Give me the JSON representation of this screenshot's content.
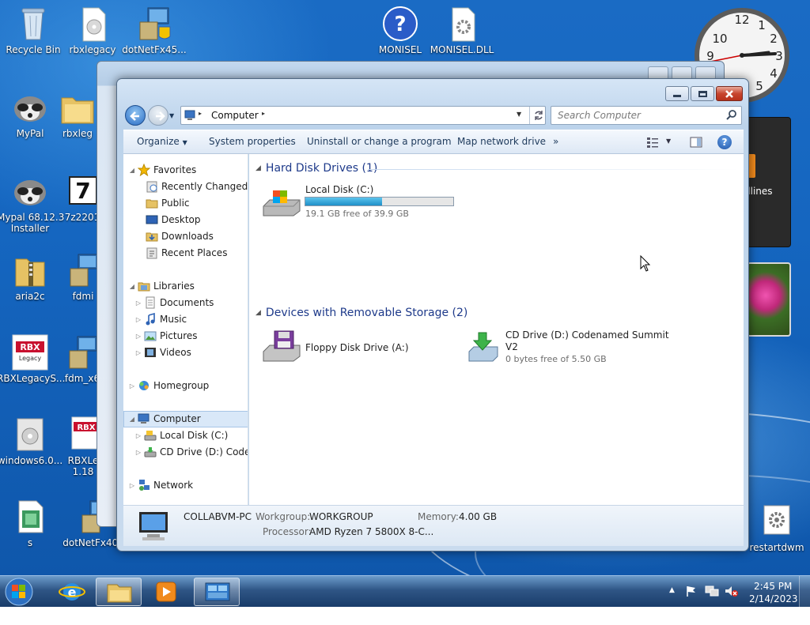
{
  "desktop": {
    "icons": [
      {
        "label": "Recycle Bin",
        "icon": "recycle-bin-icon"
      },
      {
        "label": "rbxlegacy",
        "icon": "disc-file-icon"
      },
      {
        "label": "dotNetFx45...",
        "icon": "installer-icon"
      },
      {
        "label": "MONISEL",
        "icon": "help-icon"
      },
      {
        "label": "MONISEL.DLL",
        "icon": "dll-file-icon"
      },
      {
        "label": "MyPal",
        "icon": "raccoon-icon"
      },
      {
        "label": "rbxleg",
        "icon": "folder-icon"
      },
      {
        "label": "Mypal 68.12.3",
        "label2": "Installer",
        "icon": "raccoon-icon"
      },
      {
        "label": "7z2201",
        "icon": "7zip-icon"
      },
      {
        "label": "aria2c",
        "icon": "zip-folder-icon"
      },
      {
        "label": "fdmi",
        "icon": "installer-icon"
      },
      {
        "label": "RBXLegacyS...",
        "icon": "rbx-legacy-icon"
      },
      {
        "label": "fdm_x6",
        "icon": "installer-icon"
      },
      {
        "label": "windows6.0...",
        "icon": "update-package-icon"
      },
      {
        "label": "RBXLe",
        "label2": "1.18",
        "icon": "rbx-legacy-icon"
      },
      {
        "label": "s",
        "icon": "script-icon"
      },
      {
        "label": "dotNetFx40...",
        "icon": "installer-icon"
      },
      {
        "label": "restartdwm",
        "icon": "settings-file-icon"
      }
    ],
    "gadget_headlines_text": "dlines"
  },
  "window": {
    "address": {
      "path_icon": "computer-icon",
      "segment": "Computer",
      "sep": "▸"
    },
    "search_placeholder": "Search Computer",
    "toolbar": {
      "organize": "Organize",
      "system_properties": "System properties",
      "uninstall": "Uninstall or change a program",
      "map_network": "Map network drive",
      "more": "»"
    },
    "nav": {
      "favorites": "Favorites",
      "recently_changed": "Recently Changed",
      "public": "Public",
      "desktop": "Desktop",
      "downloads": "Downloads",
      "recent_places": "Recent Places",
      "libraries": "Libraries",
      "documents": "Documents",
      "music": "Music",
      "pictures": "Pictures",
      "videos": "Videos",
      "homegroup": "Homegroup",
      "computer": "Computer",
      "local_disk": "Local Disk (C:)",
      "cd_drive": "CD Drive (D:) Coden",
      "network": "Network"
    },
    "content": {
      "hdd_header": "Hard Disk Drives (1)",
      "local_disk": {
        "name": "Local Disk (C:)",
        "free": "19.1 GB free of 39.9 GB",
        "used_fraction": 0.52
      },
      "removable_header": "Devices with Removable Storage (2)",
      "floppy": {
        "name": "Floppy Disk Drive (A:)"
      },
      "cd": {
        "name": "CD Drive (D:) Codenamed Summit",
        "name2": "V2",
        "free": "0 bytes free of 5.50 GB"
      }
    },
    "details": {
      "computer_name": "COLLABVM-PC",
      "workgroup_label": "Workgroup:",
      "workgroup_value": "WORKGROUP",
      "memory_label": "Memory:",
      "memory_value": "4.00 GB",
      "processor_label": "Processor:",
      "processor_value": "AMD Ryzen 7 5800X 8-C..."
    }
  },
  "taskbar": {
    "time": "2:45 PM",
    "date": "2/14/2023"
  },
  "colors": {
    "accent": "#1e3a8a",
    "progress": "#2aa5d8",
    "close": "#c7452f"
  }
}
